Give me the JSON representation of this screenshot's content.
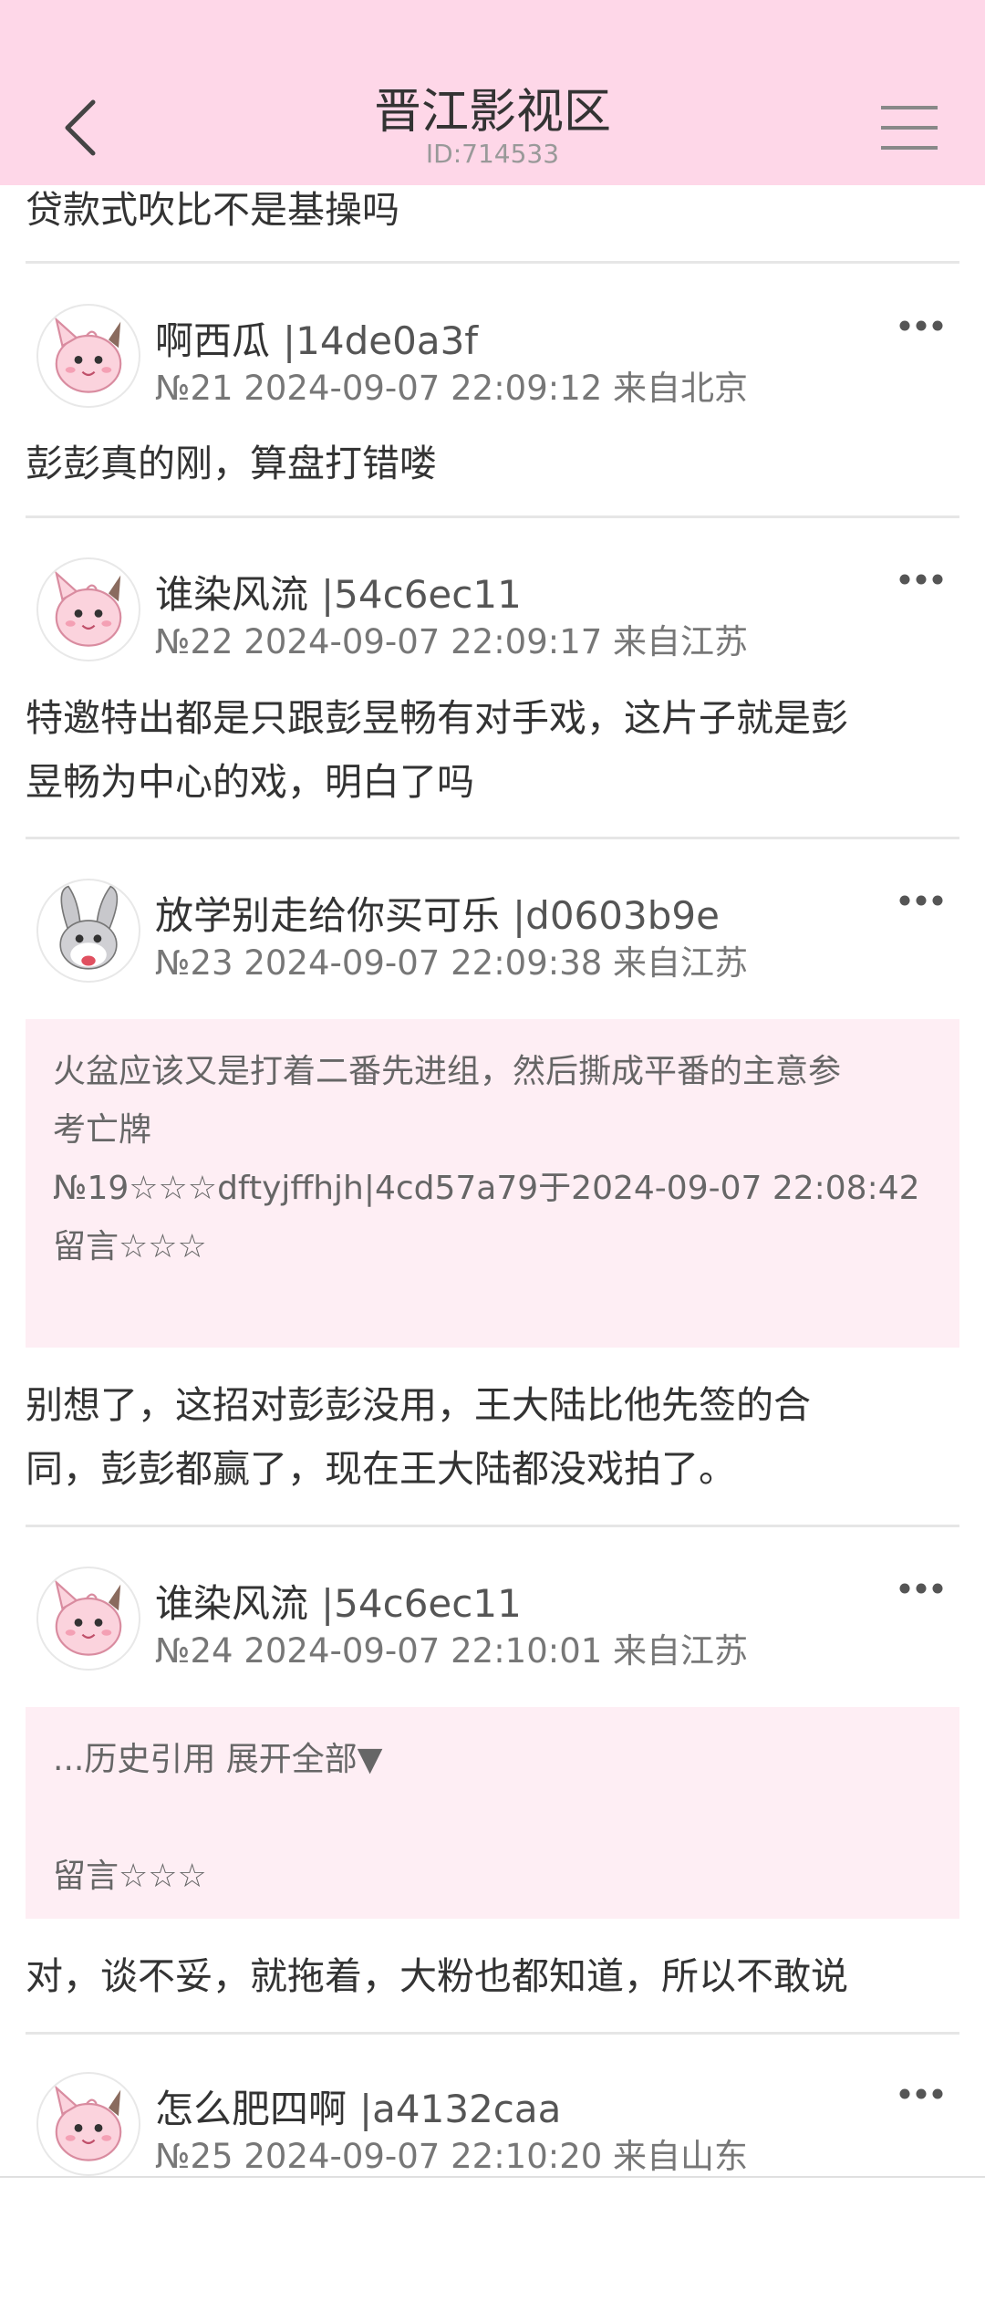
{
  "header": {
    "title": "晋江影视区",
    "id_text": "ID:714533",
    "back_icon": "chevron-left-icon",
    "menu_icon": "hamburger-menu-icon"
  },
  "partial_post": {
    "content": "贷款式吹比不是基操吗"
  },
  "posts": [
    {
      "username": "啊西瓜",
      "uid": "|14de0a3f",
      "meta": "№21 2024-09-07 22:09:12 来自北京",
      "content": "彭彭真的刚，算盘打错喽",
      "avatar": "pink-clefairy-avatar"
    },
    {
      "username": "谁染风流",
      "uid": "|54c6ec11",
      "meta": "№22 2024-09-07 22:09:17 来自江苏",
      "content_lines": [
        "特邀特出都是只跟彭昱畅有对手戏，这片子就是彭",
        "昱畅为中心的戏，明白了吗"
      ],
      "avatar": "pink-clefairy-avatar"
    },
    {
      "username": "放学别走给你买可乐",
      "uid": "|d0603b9e",
      "meta": "№23 2024-09-07 22:09:38 来自江苏",
      "quote_lines": [
        "火盆应该又是打着二番先进组，然后撕成平番的主意参",
        "考亡牌",
        "№19☆☆☆dftyjffhjh|4cd57a79于2024-09-07 22:08:42",
        "留言☆☆☆"
      ],
      "content_lines": [
        "别想了，这招对彭彭没用，王大陆比他先签的合",
        "同，彭彭都赢了，现在王大陆都没戏拍了。"
      ],
      "avatar": "bunny-avatar"
    },
    {
      "username": "谁染风流",
      "uid": "|54c6ec11",
      "meta": "№24 2024-09-07 22:10:01 来自江苏",
      "quote_lines": [
        "...历史引用 展开全部▼",
        "",
        "留言☆☆☆"
      ],
      "content": "对，谈不妥，就拖着，大粉也都知道，所以不敢说",
      "avatar": "pink-clefairy-avatar"
    },
    {
      "username": "怎么肥四啊",
      "uid": "|a4132caa",
      "meta": "№25 2024-09-07 22:10:20 来自山东",
      "avatar": "pink-clefairy-avatar"
    }
  ],
  "colors": {
    "header_bg": "#fed7e8",
    "quote_bg": "#feeef4",
    "divider": "#e6e6e6"
  }
}
